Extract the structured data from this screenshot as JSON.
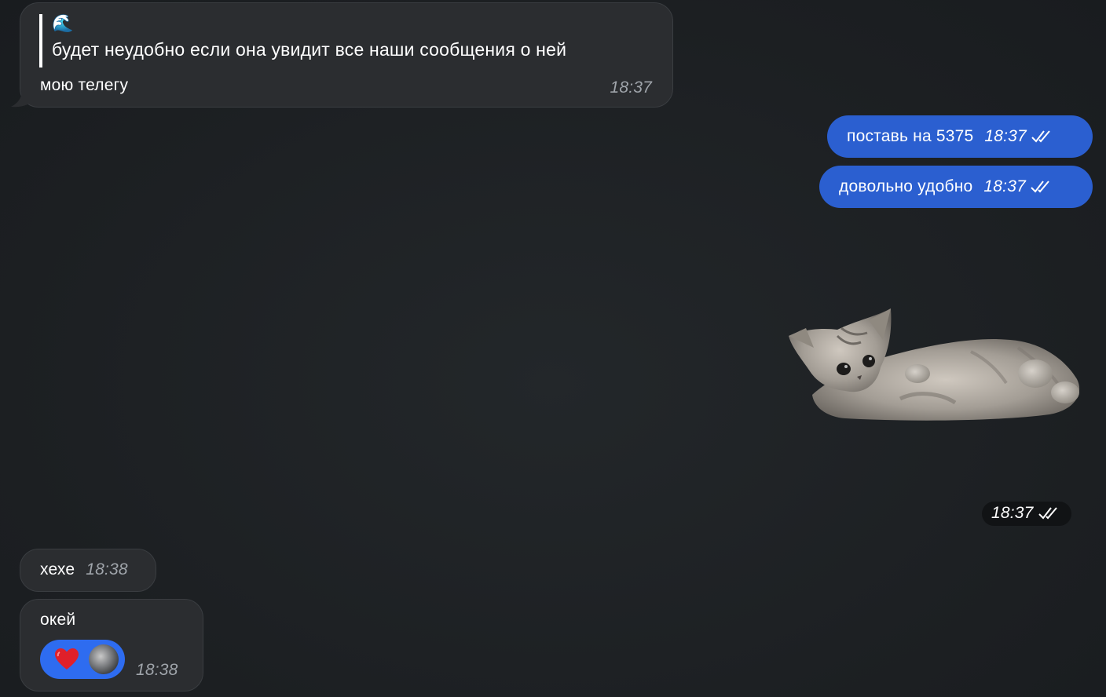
{
  "messages": {
    "m1": {
      "quote_emoji": "🌊",
      "quote_text": "будет неудобно если она увидит все наши сообщения о ней",
      "text": "мою телегу",
      "time": "18:37"
    },
    "m2": {
      "text": "поставь на 5375",
      "time": "18:37"
    },
    "m3": {
      "text": "довольно удобно",
      "time": "18:37"
    },
    "sticker": {
      "icon": "kitten-sticker",
      "time": "18:37"
    },
    "m4": {
      "text": "хехе",
      "time": "18:38"
    },
    "m5": {
      "text": "окей",
      "time": "18:38",
      "reaction_icon": "heart-icon"
    }
  },
  "colors": {
    "background": "#1e2124",
    "incoming_bubble": "#2b2d30",
    "outgoing_bubble": "#2b5fd0",
    "reaction_pill": "#2e6cf0"
  }
}
